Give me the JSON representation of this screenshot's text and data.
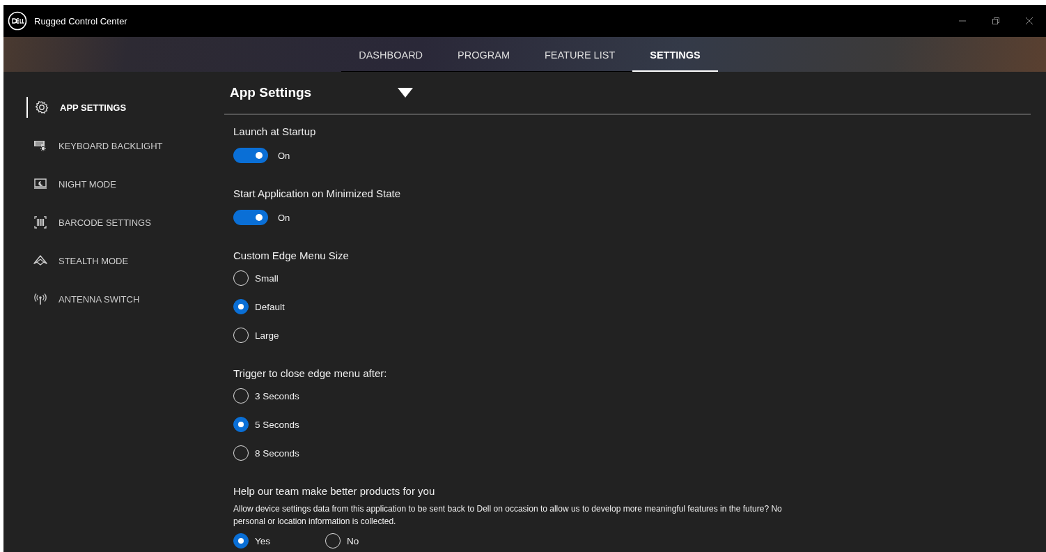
{
  "window": {
    "title": "Rugged Control Center"
  },
  "tabs": [
    {
      "label": "DASHBOARD",
      "selected": false
    },
    {
      "label": "PROGRAM",
      "selected": false
    },
    {
      "label": "FEATURE LIST",
      "selected": false
    },
    {
      "label": "SETTINGS",
      "selected": true
    }
  ],
  "sidebar": {
    "items": [
      {
        "label": "APP SETTINGS",
        "kind": "gear",
        "selected": true
      },
      {
        "label": "KEYBOARD BACKLIGHT",
        "kind": "keyboard",
        "selected": false
      },
      {
        "label": "NIGHT MODE",
        "kind": "night",
        "selected": false
      },
      {
        "label": "BARCODE SETTINGS",
        "kind": "barcode",
        "selected": false
      },
      {
        "label": "STEALTH MODE",
        "kind": "stealth",
        "selected": false
      },
      {
        "label": "ANTENNA SWITCH",
        "kind": "antenna",
        "selected": false
      }
    ]
  },
  "content": {
    "heading": "App Settings",
    "sections": [
      {
        "kind": "toggle",
        "label": "Launch at Startup",
        "on": true,
        "state_text": "On"
      },
      {
        "kind": "toggle",
        "label": "Start Application on Minimized State",
        "on": true,
        "state_text": "On"
      },
      {
        "kind": "radio",
        "label": "Custom Edge Menu Size",
        "options": [
          {
            "label": "Small",
            "selected": false
          },
          {
            "label": "Default",
            "selected": true
          },
          {
            "label": "Large",
            "selected": false
          }
        ]
      },
      {
        "kind": "radio",
        "label": "Trigger to close edge menu after:",
        "options": [
          {
            "label": "3 Seconds",
            "selected": false
          },
          {
            "label": "5 Seconds",
            "selected": true
          },
          {
            "label": "8 Seconds",
            "selected": false
          }
        ]
      },
      {
        "kind": "radio-inline",
        "label": "Help our team make better products for you",
        "description": "Allow device settings data from this application to be sent back to Dell on occasion to allow us to develop more meaningful features in the future? No personal or location information is collected.",
        "options": [
          {
            "label": "Yes",
            "selected": true
          },
          {
            "label": "No",
            "selected": false
          }
        ]
      }
    ]
  }
}
